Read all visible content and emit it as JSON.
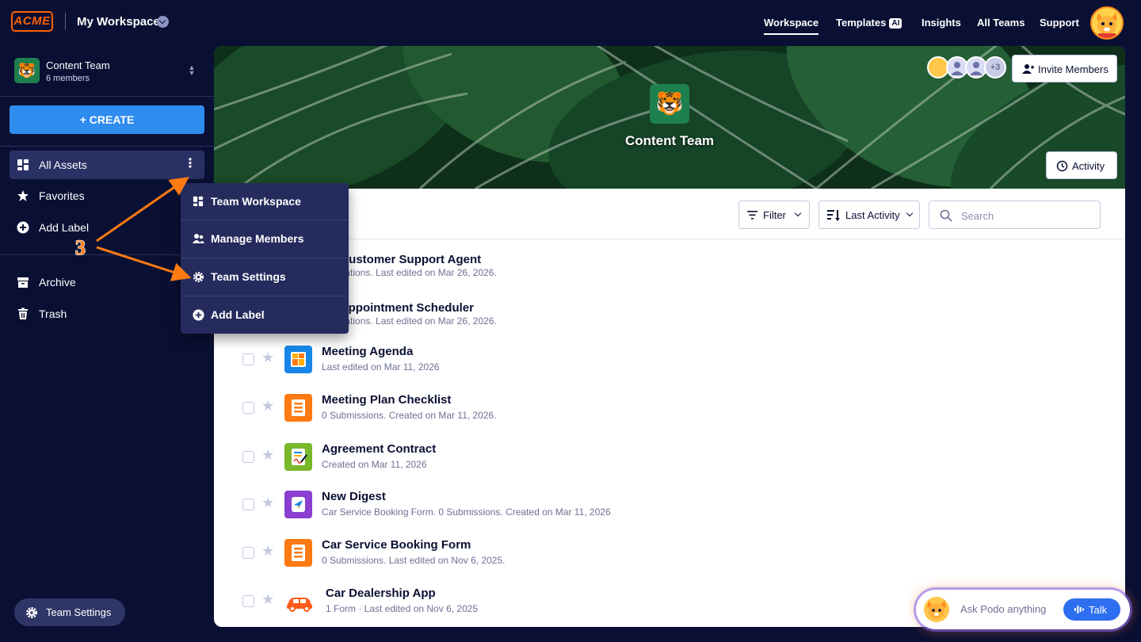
{
  "header": {
    "logo": "ACME",
    "workspace_title": "My Workspace",
    "nav": [
      {
        "label": "Workspace",
        "active": true
      },
      {
        "label": "Templates",
        "badge": "AI"
      },
      {
        "label": "Insights"
      },
      {
        "label": "All Teams"
      },
      {
        "label": "Support"
      }
    ]
  },
  "sidebar": {
    "team": {
      "name": "Content Team",
      "members": "6 members",
      "icon": "tiger-emoji"
    },
    "create_label": "+ CREATE",
    "items": [
      {
        "label": "All Assets",
        "icon": "grid-icon",
        "active": true
      },
      {
        "label": "Favorites",
        "icon": "star-icon"
      },
      {
        "label": "Add Label",
        "icon": "plus-circle-icon"
      },
      {
        "label": "Archive",
        "icon": "archive-icon"
      },
      {
        "label": "Trash",
        "icon": "trash-icon"
      }
    ],
    "footer_button": "Team Settings"
  },
  "dropdown": {
    "items": [
      {
        "label": "Team Workspace",
        "icon": "grid-icon"
      },
      {
        "label": "Manage Members",
        "icon": "users-icon"
      },
      {
        "label": "Team Settings",
        "icon": "gear-icon"
      },
      {
        "label": "Add Label",
        "icon": "plus-circle-icon"
      }
    ]
  },
  "annotation": {
    "step": "3",
    "color": "#ff7a12"
  },
  "banner": {
    "team_name": "Content Team",
    "avatar_overflow": "+3",
    "invite_label": "Invite Members",
    "activity_label": "Activity"
  },
  "toolbar": {
    "filter_label": "Filter",
    "sort_label": "Last Activity",
    "search_placeholder": "Search"
  },
  "assets": [
    {
      "title": "ra: Customer Support Agent",
      "sub": "nversations. Last edited on Mar 26, 2026.",
      "type": "agent"
    },
    {
      "title": "ra: Appointment Scheduler",
      "sub": "nversations. Last edited on Mar 26, 2026.",
      "type": "agent"
    },
    {
      "title": "Meeting Agenda",
      "sub": "Last edited on Mar 11, 2026",
      "type": "table",
      "color": "#1687e8"
    },
    {
      "title": "Meeting Plan Checklist",
      "sub": "0 Submissions.  Created on Mar 11, 2026.",
      "type": "form",
      "color": "#ff7a12"
    },
    {
      "title": "Agreement Contract",
      "sub": "Created on Mar 11, 2026",
      "type": "sign",
      "color": "#78b82a"
    },
    {
      "title": "New Digest",
      "sub": "Car Service Booking Form. 0 Submissions. Created on Mar 11, 2026",
      "type": "digest",
      "color": "#8a3fd1"
    },
    {
      "title": "Car Service Booking Form",
      "sub": "0 Submissions.  Last edited on Nov 6, 2025.",
      "type": "form",
      "color": "#ff7a12"
    },
    {
      "title": "Car Dealership App",
      "sub": "1 Form · Last edited on Nov 6, 2025",
      "type": "app",
      "color": "#ff5a1a"
    }
  ],
  "podo": {
    "prompt": "Ask Podo anything",
    "talk_label": "Talk"
  },
  "colors": {
    "background": "#0a1033",
    "accent": "#2f8df0",
    "brand_orange": "#ff6100",
    "dropdown_bg": "#252b5c"
  }
}
